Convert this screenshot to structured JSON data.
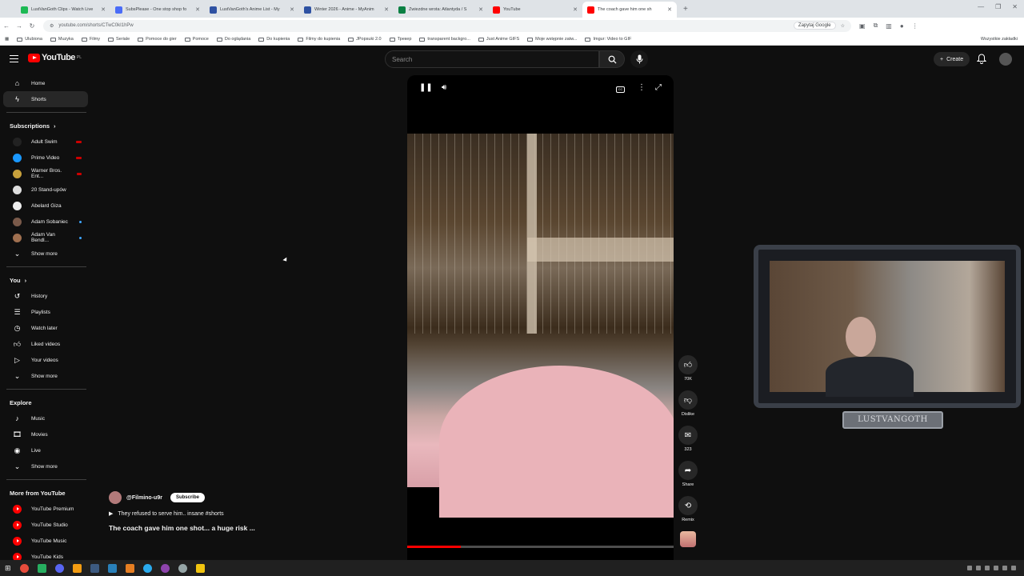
{
  "browser": {
    "tabs": [
      {
        "title": "LustVanGoth Clips - Watch Live",
        "color": "#1db954"
      },
      {
        "title": "SubsPlease - One stop shop fo",
        "color": "#4a6cf7"
      },
      {
        "title": "LustVanGoth's Anime List - My",
        "color": "#2e51a2"
      },
      {
        "title": "Winter 2026 - Anime - MyAnim",
        "color": "#2e51a2"
      },
      {
        "title": "Zwiezdne wrota: Atlantyda / S",
        "color": "#0b8043"
      },
      {
        "title": "YouTube",
        "color": "#ff0000"
      },
      {
        "title": "The coach gave him one sh",
        "color": "#ff0000",
        "active": true
      }
    ],
    "url": "youtube.com/shorts/CTwC0kI1hPw",
    "ask_google": "Zapytaj Google",
    "bookmarks": [
      "Ulubiona",
      "Muzyka",
      "Filmy",
      "Seriale",
      "Pomoce do gier",
      "Pomoce",
      "Do oglądania",
      "Do kupienia",
      "Filmy do kupienia",
      "JPopsuki 2.0",
      "Трекер",
      "transparent backgro...",
      "Just Anime GIFS",
      "Moje wstępnie zatw...",
      "Imgur: Video to GIF"
    ],
    "bookmarks_right": "Wszystkie zakładki"
  },
  "header": {
    "logo": "YouTube",
    "country": "PL",
    "search_placeholder": "Search",
    "create_label": "Create"
  },
  "sidebar": {
    "main": [
      {
        "label": "Home",
        "icon": "home-icon"
      },
      {
        "label": "Shorts",
        "icon": "shorts-icon",
        "selected": true
      }
    ],
    "subscriptions_heading": "Subscriptions",
    "subscriptions": [
      {
        "label": "Adult Swim",
        "color": "#222222",
        "status": "live"
      },
      {
        "label": "Prime Video",
        "color": "#1a98ff",
        "status": "live"
      },
      {
        "label": "Warner Bros. Ent...",
        "color": "#c8a13c",
        "status": "live"
      },
      {
        "label": "20 Stand-upów",
        "color": "#dddddd",
        "status": ""
      },
      {
        "label": "Abelard Giza",
        "color": "#eeeeee",
        "status": ""
      },
      {
        "label": "Adam Sobaniec",
        "color": "#7a5a4a",
        "status": "dot"
      },
      {
        "label": "Adam Van Bendl...",
        "color": "#a07050",
        "status": "dot"
      }
    ],
    "subs_show_more": "Show more",
    "you_heading": "You",
    "you": [
      {
        "label": "History",
        "icon": "history-icon"
      },
      {
        "label": "Playlists",
        "icon": "playlists-icon"
      },
      {
        "label": "Watch later",
        "icon": "watch-later-icon"
      },
      {
        "label": "Liked videos",
        "icon": "liked-videos-icon"
      },
      {
        "label": "Your videos",
        "icon": "your-videos-icon"
      },
      {
        "label": "Show more",
        "icon": "chevron-down-icon"
      }
    ],
    "explore_heading": "Explore",
    "explore": [
      {
        "label": "Music",
        "icon": "music-icon"
      },
      {
        "label": "Movies",
        "icon": "movies-icon"
      },
      {
        "label": "Live",
        "icon": "live-icon"
      },
      {
        "label": "Show more",
        "icon": "chevron-down-icon"
      }
    ],
    "more_heading": "More from YouTube",
    "more": [
      "YouTube Premium",
      "YouTube Studio",
      "YouTube Music",
      "YouTube Kids"
    ]
  },
  "short": {
    "channel": "@Filmino-u9r",
    "subscribe": "Subscribe",
    "description": "They refused to serve him.. insane #shorts",
    "title": "The coach gave him one shot... a huge risk ...",
    "progress_fraction": 0.2,
    "actions": [
      {
        "name": "like",
        "icon": "thumbs-up-icon",
        "label": "70K"
      },
      {
        "name": "dislike",
        "icon": "thumbs-down-icon",
        "label": "Dislike"
      },
      {
        "name": "comments",
        "icon": "comment-icon",
        "label": "323"
      },
      {
        "name": "share",
        "icon": "share-icon",
        "label": "Share"
      },
      {
        "name": "remix",
        "icon": "remix-icon",
        "label": "Remix"
      }
    ]
  },
  "overlay": {
    "nameplate": "LUSTVANGOTH"
  }
}
